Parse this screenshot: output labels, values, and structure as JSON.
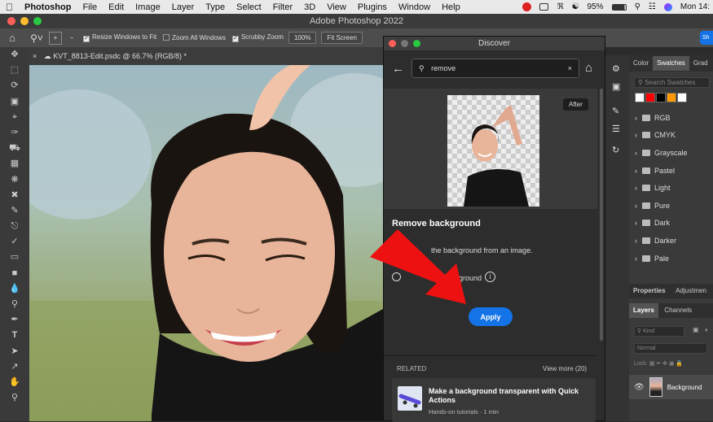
{
  "menubar": {
    "app": "Photoshop",
    "items": [
      "File",
      "Edit",
      "Image",
      "Layer",
      "Type",
      "Select",
      "Filter",
      "3D",
      "View",
      "Plugins",
      "Window",
      "Help"
    ],
    "battery": "95%",
    "clock": "Mon 14:"
  },
  "titlebar": {
    "title": "Adobe Photoshop 2022"
  },
  "options": {
    "resize": "Resize Windows to Fit",
    "zoom_all": "Zoom All Windows",
    "scrubby": "Scrubby Zoom",
    "zoom_value": "100%",
    "fit_screen": "Fit Screen"
  },
  "tab": {
    "label": "KVT_8813-Edit.psdc @ 66.7% (RGB/8) *"
  },
  "discover": {
    "title": "Discover",
    "search_value": "remove",
    "after_badge": "After",
    "heading": "Remove background",
    "description": "the background from an image.",
    "partial_text": "ground",
    "apply": "Apply",
    "related_label": "RELATED",
    "view_more": "View more (20)",
    "related_title": "Make a background transparent with Quick Actions",
    "related_meta": "Hands-on tutorials  ·  1 min"
  },
  "panel_tabs": {
    "color": "Color",
    "swatches": "Swatches",
    "gradients": "Grad"
  },
  "swatch_search": "Search Swatches",
  "swatch_colors": [
    "#ffffff",
    "#ff0000",
    "#000000",
    "#ff9900",
    "#ffffff"
  ],
  "folders": [
    "RGB",
    "CMYK",
    "Grayscale",
    "Pastel",
    "Light",
    "Pure",
    "Dark",
    "Darker",
    "Pale"
  ],
  "props_tabs": {
    "properties": "Properties",
    "adjustments": "Adjustmen"
  },
  "layers_tabs": {
    "layers": "Layers",
    "channels": "Channels"
  },
  "layers": {
    "kind": "Kind",
    "blend": "Normal",
    "lock": "Lock:",
    "background": "Background"
  },
  "accent": "#1473e6",
  "arrow_color": "#ee1111"
}
